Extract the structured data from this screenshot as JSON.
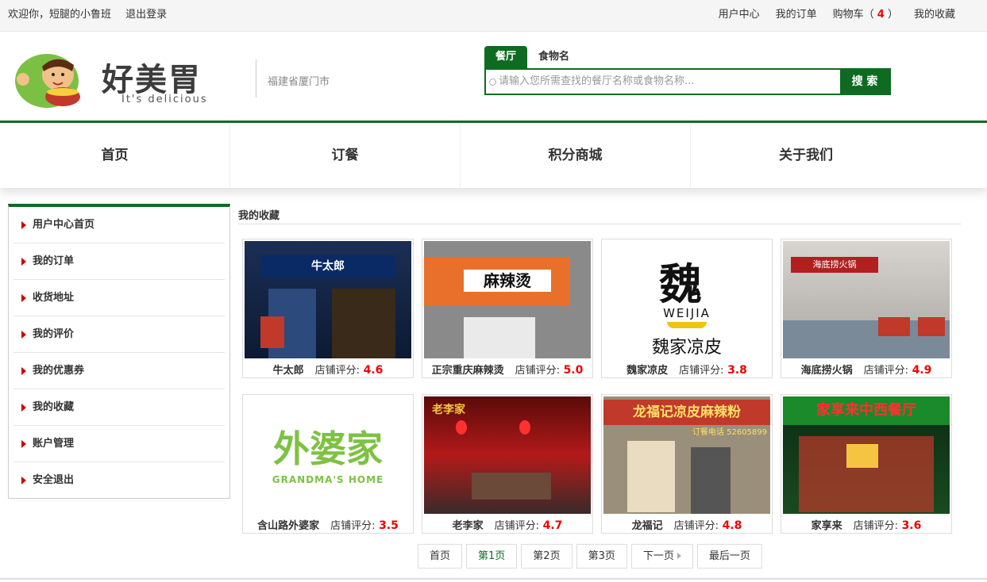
{
  "topbar": {
    "welcome": "欢迎你，短腿的小鲁班",
    "logout": "退出登录",
    "user_center": "用户中心",
    "orders": "我的订单",
    "cart_label": "购物车（",
    "cart_count": "4",
    "cart_close": "）",
    "favorites": "我的收藏"
  },
  "header": {
    "brand": "好美胃",
    "slogan": "It's delicious",
    "city": "福建省厦门市"
  },
  "search": {
    "tabs": [
      "餐厅",
      "食物名"
    ],
    "placeholder": "请输入您所需查找的餐厅名称或食物名称...",
    "button": "搜 索"
  },
  "nav": [
    "首页",
    "订餐",
    "积分商城",
    "关于我们"
  ],
  "sidebar": [
    "用户中心首页",
    "我的订单",
    "收货地址",
    "我的评价",
    "我的优惠券",
    "我的收藏",
    "账户管理",
    "安全退出"
  ],
  "content_title": "我的收藏",
  "score_label": "店铺评分:",
  "restaurants": [
    {
      "name": "牛太郎",
      "score": "4.6",
      "sign": "牛太郎"
    },
    {
      "name": "正宗重庆麻辣烫",
      "score": "5.0",
      "sign": "麻辣烫"
    },
    {
      "name": "魏家凉皮",
      "score": "3.8",
      "sign": "魏家凉皮",
      "sub": "WEIJIA"
    },
    {
      "name": "海底捞火锅",
      "score": "4.9",
      "sign": "海底捞火锅"
    },
    {
      "name": "含山路外婆家",
      "score": "3.5",
      "sign": "外婆家",
      "sub": "GRANDMA'S HOME"
    },
    {
      "name": "老李家",
      "score": "4.7",
      "sign": "老李家"
    },
    {
      "name": "龙福记",
      "score": "4.8",
      "sign": "龙福记凉皮麻辣粉",
      "sub": "订餐电话 52605899"
    },
    {
      "name": "家享来",
      "score": "3.6",
      "sign": "家享来中西餐厅"
    }
  ],
  "pager": [
    "首页",
    "第1页",
    "第2页",
    "第3页",
    "下一页",
    "最后一页"
  ],
  "colors": {
    "brand_green": "#0e6b21",
    "score_red": "#e00000"
  }
}
